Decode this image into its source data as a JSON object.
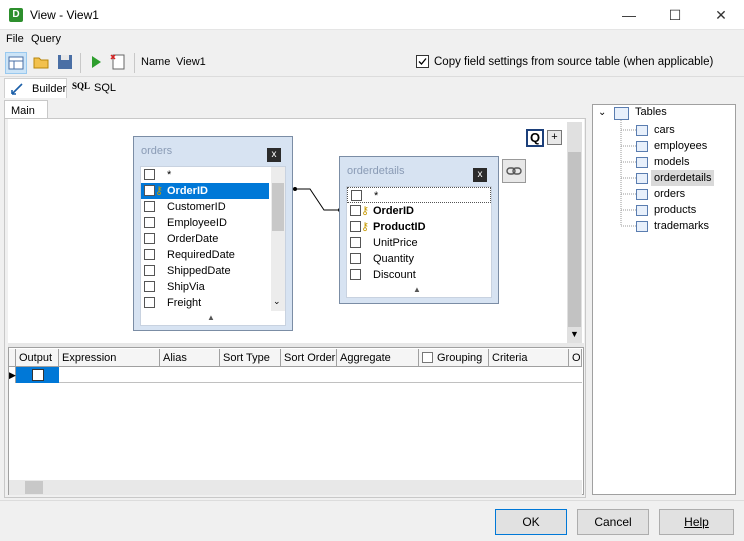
{
  "window": {
    "title": "View - View1",
    "min": "—",
    "max": "☐",
    "close": "✕",
    "app_letter": "D"
  },
  "menu": [
    {
      "label": "File"
    },
    {
      "label": "Query"
    }
  ],
  "toolbar": {
    "name_label": "Name",
    "name_value": "View1",
    "copy_settings_label": "Copy field settings from source table (when applicable)",
    "copy_settings_checked": true
  },
  "mode_tabs": [
    {
      "label": "Builder"
    },
    {
      "label": "SQL",
      "prefix": "SQL"
    }
  ],
  "sub_tabs": [
    {
      "label": "Main"
    }
  ],
  "designer": {
    "q_button": "Q",
    "plus_button": "+",
    "tables": [
      {
        "name": "orders",
        "close": "x",
        "fields": [
          "*",
          "OrderID",
          "CustomerID",
          "EmployeeID",
          "OrderDate",
          "RequiredDate",
          "ShippedDate",
          "ShipVia",
          "Freight"
        ]
      },
      {
        "name": "orderdetails",
        "close": "x",
        "fields": [
          "*",
          "OrderID",
          "ProductID",
          "UnitPrice",
          "Quantity",
          "Discount"
        ]
      }
    ]
  },
  "grid": {
    "columns": [
      "Output",
      "Expression",
      "Alias",
      "Sort Type",
      "Sort Order",
      "Aggregate",
      "Grouping",
      "Criteria",
      "Or"
    ]
  },
  "tree": {
    "root": "Tables",
    "items": [
      "cars",
      "employees",
      "models",
      "orderdetails",
      "orders",
      "products",
      "trademarks"
    ],
    "selected": "orderdetails"
  },
  "buttons": {
    "ok": "OK",
    "cancel": "Cancel",
    "help": "Help"
  }
}
